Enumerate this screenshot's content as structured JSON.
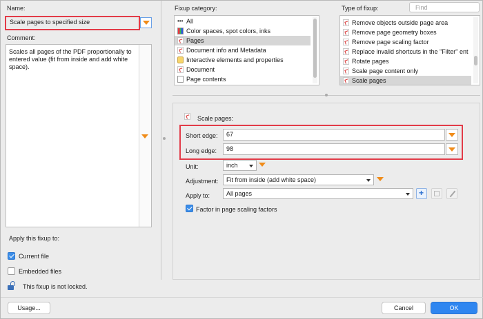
{
  "left": {
    "name_label": "Name:",
    "name_value": "Scale pages to specified size",
    "comment_label": "Comment:",
    "comment_text": "Scales all pages of the PDF proportionally to entered value (fit from inside and add white space).",
    "apply_label": "Apply this fixup to:",
    "current_file": "Current file",
    "embedded_files": "Embedded files",
    "lock_text": "This fixup is not locked."
  },
  "category": {
    "label": "Fixup category:",
    "items": [
      {
        "label": "All",
        "icon": "dots-icon"
      },
      {
        "label": "Color spaces, spot colors, inks",
        "icon": "color-swatch-icon"
      },
      {
        "label": "Pages",
        "icon": "pdf-icon"
      },
      {
        "label": "Document info and Metadata",
        "icon": "pdf-icon"
      },
      {
        "label": "Interactive elements and properties",
        "icon": "interactive-icon"
      },
      {
        "label": "Document",
        "icon": "pdf-icon"
      },
      {
        "label": "Page contents",
        "icon": "page-icon"
      }
    ],
    "selected_index": 2
  },
  "type": {
    "label": "Type of fixup:",
    "search_placeholder": "Find",
    "items": [
      "Remove objects outside page area",
      "Remove page geometry boxes",
      "Remove page scaling factor",
      "Replace invalid shortcuts in the \"Filter\" ent",
      "Rotate pages",
      "Scale page content only",
      "Scale pages"
    ],
    "selected_index": 6
  },
  "params": {
    "title": "Scale pages:",
    "short_edge_label": "Short edge:",
    "short_edge_value": "67",
    "long_edge_label": "Long edge:",
    "long_edge_value": "98",
    "unit_label": "Unit:",
    "unit_value": "inch",
    "adjustment_label": "Adjustment:",
    "adjustment_value": "Fit from inside (add white space)",
    "apply_to_label": "Apply to:",
    "apply_to_value": "All pages",
    "factor_label": "Factor in page scaling factors"
  },
  "footer": {
    "usage": "Usage...",
    "cancel": "Cancel",
    "ok": "OK"
  },
  "colors": {
    "accent_orange": "#f08c1a",
    "highlight_red": "#e23b48",
    "primary_blue": "#2f86f0"
  }
}
